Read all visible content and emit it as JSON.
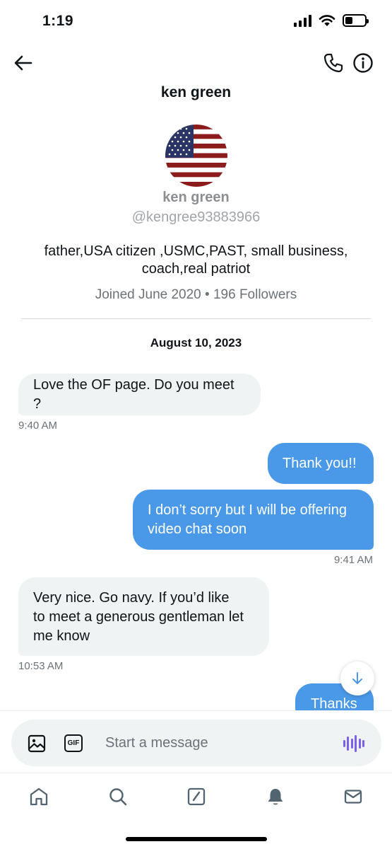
{
  "status_bar": {
    "time": "1:19",
    "battery_level": 0.4
  },
  "header": {
    "title": "ken green",
    "back_icon": "arrow-left-icon",
    "call_icon": "phone-icon",
    "info_icon": "info-icon"
  },
  "profile": {
    "avatar": "american-flag-avatar",
    "name": "ken green",
    "handle": "@kengree93883966",
    "bio_line1": "father,USA citizen ,USMC,PAST, small business,",
    "bio_line2": "coach,real patriot",
    "meta": "Joined June 2020 • 196 Followers"
  },
  "conversation": {
    "date": "August 10, 2023",
    "messages": [
      {
        "direction": "incoming",
        "text": "Love the OF page. Do you meet ?",
        "time": "9:40 AM"
      },
      {
        "direction": "outgoing",
        "text": "Thank you!!"
      },
      {
        "direction": "outgoing",
        "line1": "I don’t sorry but I will be offering",
        "line2": "video chat soon",
        "time": "9:41 AM"
      },
      {
        "direction": "incoming",
        "line1": "Very nice.  Go navy.  If you’d like",
        "line2": "to meet a generous gentleman let",
        "line3": "me know",
        "time": "10:53 AM"
      },
      {
        "direction": "outgoing",
        "text": "Thanks"
      }
    ]
  },
  "composer": {
    "placeholder": "Start a message",
    "gif_label": "GIF",
    "image_icon": "image-icon",
    "voice_icon": "voice-waveform-icon"
  },
  "tab_bar": {
    "tabs": [
      "home-icon",
      "search-icon",
      "compose-icon",
      "bell-icon",
      "mail-icon"
    ]
  }
}
